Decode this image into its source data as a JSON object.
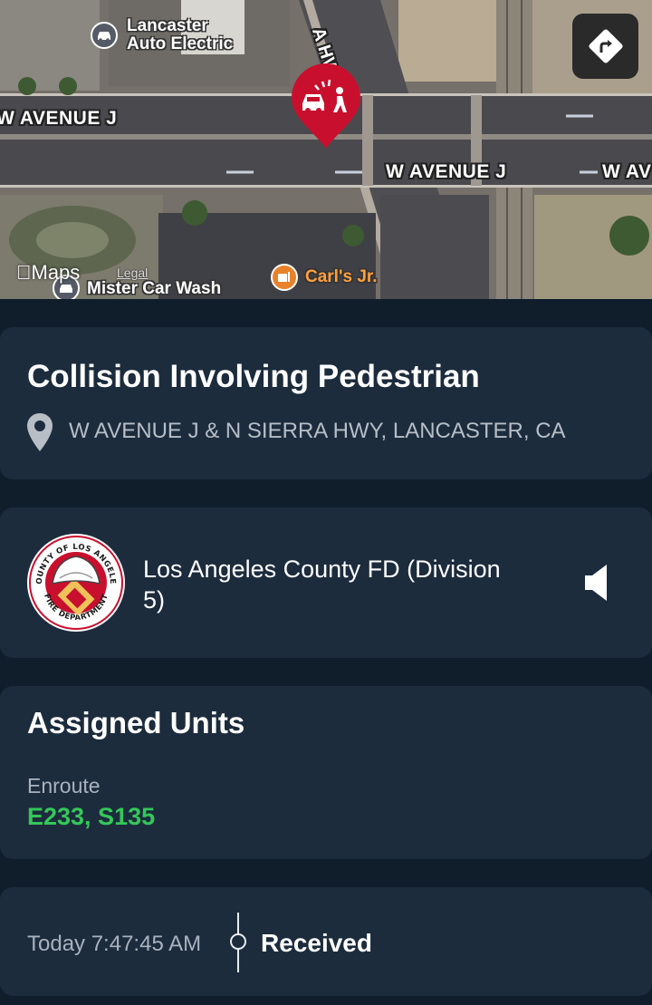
{
  "map": {
    "labels": {
      "street_top_left": "W AVENUE J",
      "street_right": "W AVENUE J",
      "street_far_right": "W AV",
      "highway": "A HWY"
    },
    "pois": {
      "auto_electric_line1": "Lancaster",
      "auto_electric_line2": "Auto Electric",
      "carls_jr": "Carl's Jr.",
      "car_wash": "Mister Car Wash"
    },
    "brand": "Maps",
    "legal": "Legal",
    "pin_icon": "car-pedestrian-collision-icon",
    "directions_icon": "directions-icon",
    "colors": {
      "pin": "#c8102e",
      "poi_food": "#e8822a"
    }
  },
  "incident": {
    "title": "Collision Involving Pedestrian",
    "location": "W AVENUE J & N SIERRA HWY, LANCASTER, CA",
    "location_icon": "location-pin-icon"
  },
  "agency": {
    "name": "Los Angeles County FD (Division 5)",
    "logo_icon": "la-county-fire-department-seal",
    "logo_text_top": "COUNTY OF LOS ANGELES",
    "logo_text_bottom": "FIRE DEPARTMENT",
    "audio_icon": "speaker-icon"
  },
  "units": {
    "heading": "Assigned Units",
    "status_label": "Enroute",
    "status_units": "E233, S135",
    "status_color": "#34c759"
  },
  "timeline": {
    "entries": [
      {
        "time": "Today 7:47:45 AM",
        "status": "Received"
      }
    ]
  }
}
